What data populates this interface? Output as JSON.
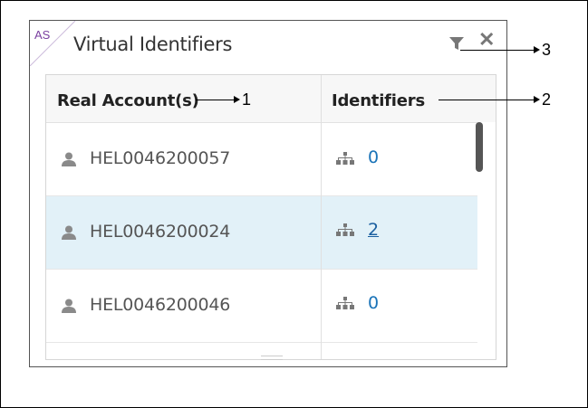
{
  "widget": {
    "tag": "AS",
    "title": "Virtual Identifiers",
    "close_label": "✕"
  },
  "table": {
    "columns": [
      "Real Account(s)",
      "Identifiers"
    ],
    "rows": [
      {
        "account": "HEL0046200057",
        "identifiers": "0",
        "selected": false
      },
      {
        "account": "HEL0046200024",
        "identifiers": "2",
        "selected": true
      },
      {
        "account": "HEL0046200046",
        "identifiers": "0",
        "selected": false
      }
    ]
  },
  "annotations": [
    "1",
    "2",
    "3"
  ],
  "icons": [
    "person-icon",
    "hierarchy-icon",
    "filter-icon",
    "close-icon"
  ]
}
